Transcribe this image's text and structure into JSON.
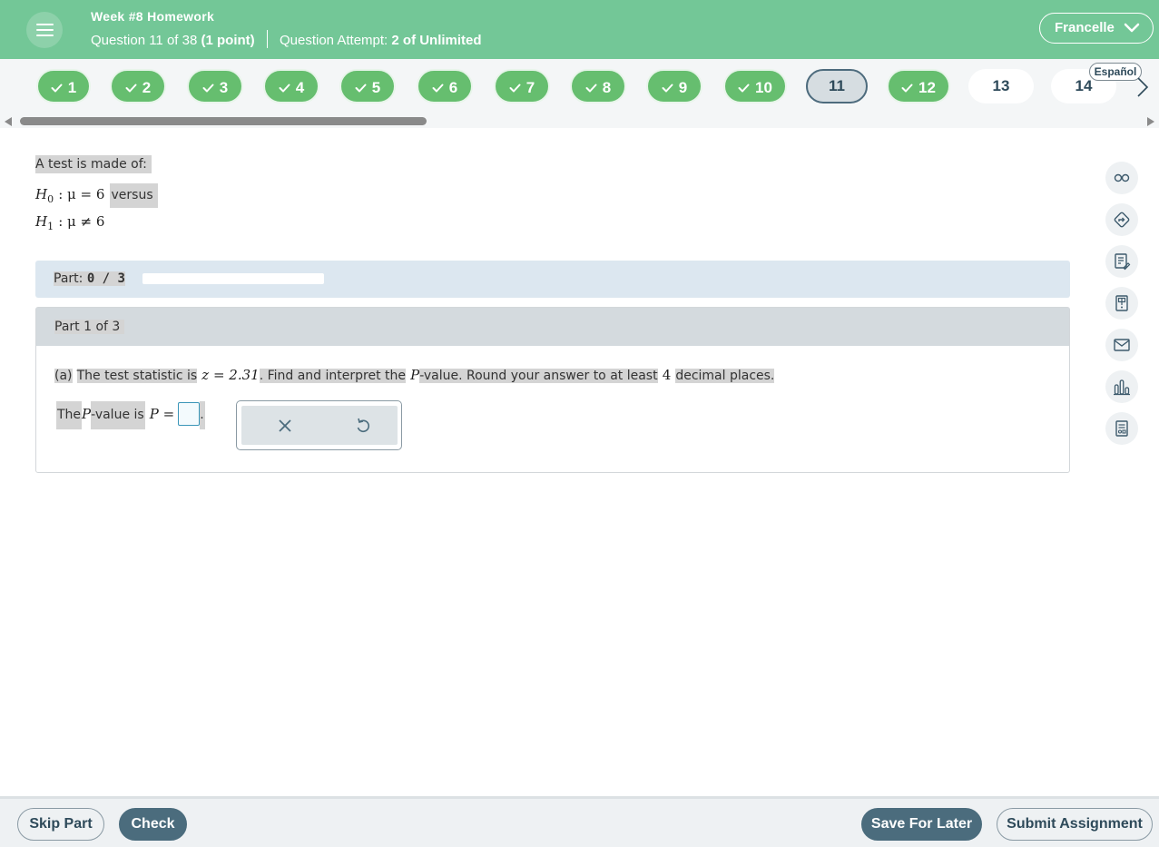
{
  "header": {
    "assignment_title": "Week #8 Homework",
    "question_prefix": "Question 11 of 38",
    "points": "(1 point)",
    "attempt_prefix": "Question Attempt:",
    "attempt_value": "2 of Unlimited",
    "user_name": "Francelle"
  },
  "question_nav": {
    "items": [
      {
        "label": "1",
        "status": "completed"
      },
      {
        "label": "2",
        "status": "completed"
      },
      {
        "label": "3",
        "status": "completed"
      },
      {
        "label": "4",
        "status": "completed"
      },
      {
        "label": "5",
        "status": "completed"
      },
      {
        "label": "6",
        "status": "completed"
      },
      {
        "label": "7",
        "status": "completed"
      },
      {
        "label": "8",
        "status": "completed"
      },
      {
        "label": "9",
        "status": "completed"
      },
      {
        "label": "10",
        "status": "completed"
      },
      {
        "label": "11",
        "status": "current"
      },
      {
        "label": "12",
        "status": "completed"
      },
      {
        "label": "13",
        "status": "unanswered"
      },
      {
        "label": "14",
        "status": "unanswered"
      }
    ],
    "language_button": "Español"
  },
  "question": {
    "prompt": "A test is made of:",
    "h0_symbol": "H",
    "h0_sub": "0",
    "h0_expr": ": μ = 6",
    "h0_suffix": "versus",
    "h1_symbol": "H",
    "h1_sub": "1",
    "h1_expr": ": μ ≠ 6"
  },
  "progress": {
    "label": "Part:",
    "value": "0 / 3",
    "fraction": 0
  },
  "part": {
    "header": "Part 1 of 3",
    "label": "(a)",
    "text1": "The test statistic is",
    "z_expr": "z = 2.31",
    "text2": ". Find and interpret the",
    "p_var": "P",
    "text3": "-value. Round your answer to at least",
    "digits": "4",
    "text4": "decimal places.",
    "answer_text1": "The",
    "answer_var": "P",
    "answer_text2": "-value is",
    "answer_expr": "P =",
    "answer_value": "",
    "answer_period": "."
  },
  "popup": {
    "clear_icon": "close-icon",
    "undo_icon": "undo-icon"
  },
  "tools": [
    "glasses-icon",
    "directions-icon",
    "notes-icon",
    "calculator-icon",
    "mail-icon",
    "bar-chart-icon",
    "data-table-icon"
  ],
  "footer": {
    "skip": "Skip Part",
    "check": "Check",
    "save": "Save For Later",
    "submit": "Submit Assignment"
  },
  "colors": {
    "header_green": "#73c797",
    "completed_green": "#66be6f",
    "dark_slate": "#4b6c7d"
  }
}
